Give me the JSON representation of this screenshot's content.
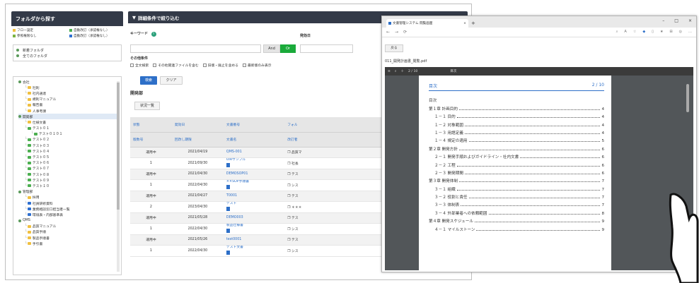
{
  "left": {
    "header": "フォルダから探す",
    "legend": [
      {
        "color": "#f0c040",
        "label": "フロー設定"
      },
      {
        "color": "#4caf50",
        "label": "自動改訂（承認権なし）"
      },
      {
        "color": "#7cb342",
        "label": "参照権限なし"
      },
      {
        "color": "#2e6fd0",
        "label": "自動改訂（承認権なし）"
      }
    ],
    "top_folders": [
      "新着フォルダ",
      "全てのフォルダ"
    ],
    "tree": [
      {
        "indent": 0,
        "icon": "circle",
        "label": "会社"
      },
      {
        "indent": 1,
        "icon": "yellow",
        "label": "社則"
      },
      {
        "indent": 1,
        "icon": "yellow",
        "label": "社内通達"
      },
      {
        "indent": 1,
        "icon": "yellow",
        "label": "規則マニュアル"
      },
      {
        "indent": 1,
        "icon": "yellow",
        "label": "報告書"
      },
      {
        "indent": 1,
        "icon": "yellow",
        "label": "人事考課"
      },
      {
        "indent": 0,
        "icon": "circle",
        "label": "開発部",
        "selected": true
      },
      {
        "indent": 1,
        "icon": "yellow",
        "label": "仕様文書"
      },
      {
        "indent": 1,
        "icon": "green",
        "label": "テスト０１"
      },
      {
        "indent": 2,
        "icon": "green",
        "label": "テスト０１０１"
      },
      {
        "indent": 1,
        "icon": "green",
        "label": "テスト０２"
      },
      {
        "indent": 1,
        "icon": "green",
        "label": "テスト０３"
      },
      {
        "indent": 1,
        "icon": "green",
        "label": "テスト０４"
      },
      {
        "indent": 1,
        "icon": "green",
        "label": "テスト０５"
      },
      {
        "indent": 1,
        "icon": "green",
        "label": "テスト０６"
      },
      {
        "indent": 1,
        "icon": "green",
        "label": "テスト０７"
      },
      {
        "indent": 1,
        "icon": "green",
        "label": "テスト０８"
      },
      {
        "indent": 1,
        "icon": "green",
        "label": "テスト０９"
      },
      {
        "indent": 1,
        "icon": "green",
        "label": "テスト１０"
      },
      {
        "indent": 0,
        "icon": "circle",
        "label": "管理部"
      },
      {
        "indent": 1,
        "icon": "yellow",
        "label": "採用"
      },
      {
        "indent": 1,
        "icon": "blue",
        "label": "社員研修資料"
      },
      {
        "indent": 1,
        "icon": "blue",
        "label": "業務相談窓口担当者一覧"
      },
      {
        "indent": 1,
        "icon": "blue",
        "label": "環境表・内部基準表"
      },
      {
        "indent": 0,
        "icon": "circle",
        "label": "QMS"
      },
      {
        "indent": 1,
        "icon": "yellow",
        "label": "品質マニュアル"
      },
      {
        "indent": 1,
        "icon": "yellow",
        "label": "品質手順"
      },
      {
        "indent": 1,
        "icon": "yellow",
        "label": "製品手順書"
      },
      {
        "indent": 1,
        "icon": "yellow",
        "label": "手引書"
      }
    ]
  },
  "filter": {
    "header": "詳細条件で絞り込む",
    "keyword_label": "キーワード",
    "and_label": "And",
    "or_label": "Or",
    "date_label": "発効日",
    "other_label": "その他条件",
    "options": [
      "全文検索",
      "その他関連ファイルを含む",
      "旧版・廃止を含める",
      "最新版のみ表示"
    ],
    "search_btn": "検索",
    "clear_btn": "クリア"
  },
  "dept_title": "開発部",
  "status_btn": "状況一覧",
  "table": {
    "headers1": [
      "状態",
      "発効日",
      "文書番号",
      "フォル"
    ],
    "headers2": [
      "版数号",
      "回改し期限",
      "文書名",
      "改訂者"
    ],
    "rows": [
      {
        "a": "運用中",
        "b": "2021/04/19",
        "c": "QMS-001",
        "d": "品質マ"
      },
      {
        "a": "1",
        "b": "2021/09/30",
        "c": "UIRサンプル",
        "d": "社長"
      },
      {
        "a": "運用中",
        "b": "2021/04/30",
        "c": "DEMOSOP01",
        "d": "テス"
      },
      {
        "a": "1",
        "b": "2022/04/30",
        "c": "××SOP手順書",
        "d": "シス"
      },
      {
        "a": "運用中",
        "b": "2021/04/27",
        "c": "T0001",
        "d": "テス"
      },
      {
        "a": "2",
        "b": "2023/04/30",
        "c": "テスト",
        "d": "＊＊＊"
      },
      {
        "a": "運用中",
        "b": "2021/05/28",
        "c": "DEMO003",
        "d": "テス"
      },
      {
        "a": "1",
        "b": "2022/04/30",
        "c": "製品仕様書",
        "d": "シス"
      },
      {
        "a": "運用中",
        "b": "2021/05/26",
        "c": "test0001",
        "d": "テス"
      },
      {
        "a": "1",
        "b": "2022/04/30",
        "c": "テスト文書",
        "d": "シス"
      }
    ]
  },
  "browser": {
    "tab_title": "文書管理システム 閲覧画面",
    "back_btn": "戻る",
    "filename": "011_開発計画書_閲覧.pdf",
    "pdf_toolbar": "目次",
    "pdf_page_num": "2 / 10",
    "toc_title": "目次",
    "toc": [
      {
        "t": "目次",
        "p": "",
        "sub": false
      },
      {
        "t": "第１章 計画目的",
        "p": "4",
        "sub": false
      },
      {
        "t": "１－１ 目的",
        "p": "4",
        "sub": true
      },
      {
        "t": "１－２ 対象範囲",
        "p": "4",
        "sub": true
      },
      {
        "t": "１－３ 用語定義",
        "p": "4",
        "sub": true
      },
      {
        "t": "１－４ 規定の適用",
        "p": "5",
        "sub": true
      },
      {
        "t": "第２章 開発方針",
        "p": "6",
        "sub": false
      },
      {
        "t": "２－１ 開発手順およびガイドライン・社内文書",
        "p": "6",
        "sub": true
      },
      {
        "t": "２－２ 工程",
        "p": "6",
        "sub": true
      },
      {
        "t": "２－３ 開発期間",
        "p": "6",
        "sub": true
      },
      {
        "t": "第３章 開発体制",
        "p": "7",
        "sub": false
      },
      {
        "t": "３－１ 組織",
        "p": "7",
        "sub": true
      },
      {
        "t": "３－２ 役割と責任",
        "p": "7",
        "sub": true
      },
      {
        "t": "３－３ 体制表",
        "p": "7",
        "sub": true
      },
      {
        "t": "３－４ 外部業者への依頼範囲",
        "p": "8",
        "sub": true
      },
      {
        "t": "第４章 開発スケジュール",
        "p": "9",
        "sub": false
      },
      {
        "t": "４－１ マイルストーン",
        "p": "9",
        "sub": true
      }
    ]
  }
}
